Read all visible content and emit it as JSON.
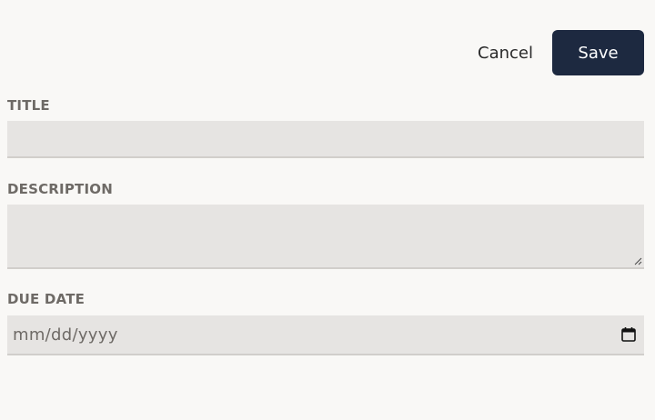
{
  "actions": {
    "cancel_label": "Cancel",
    "save_label": "Save"
  },
  "fields": {
    "title": {
      "label": "TITLE",
      "value": ""
    },
    "description": {
      "label": "DESCRIPTION",
      "value": ""
    },
    "due_date": {
      "label": "DUE DATE",
      "placeholder": "mm/dd/yyyy"
    }
  },
  "icons": {
    "calendar": "calendar-icon",
    "resize": "resize-grip-icon"
  },
  "colors": {
    "save_button_bg": "#1d2940",
    "input_bg": "#e6e4e2",
    "label_text": "#6e6a66",
    "page_bg": "#f9f8f6"
  }
}
